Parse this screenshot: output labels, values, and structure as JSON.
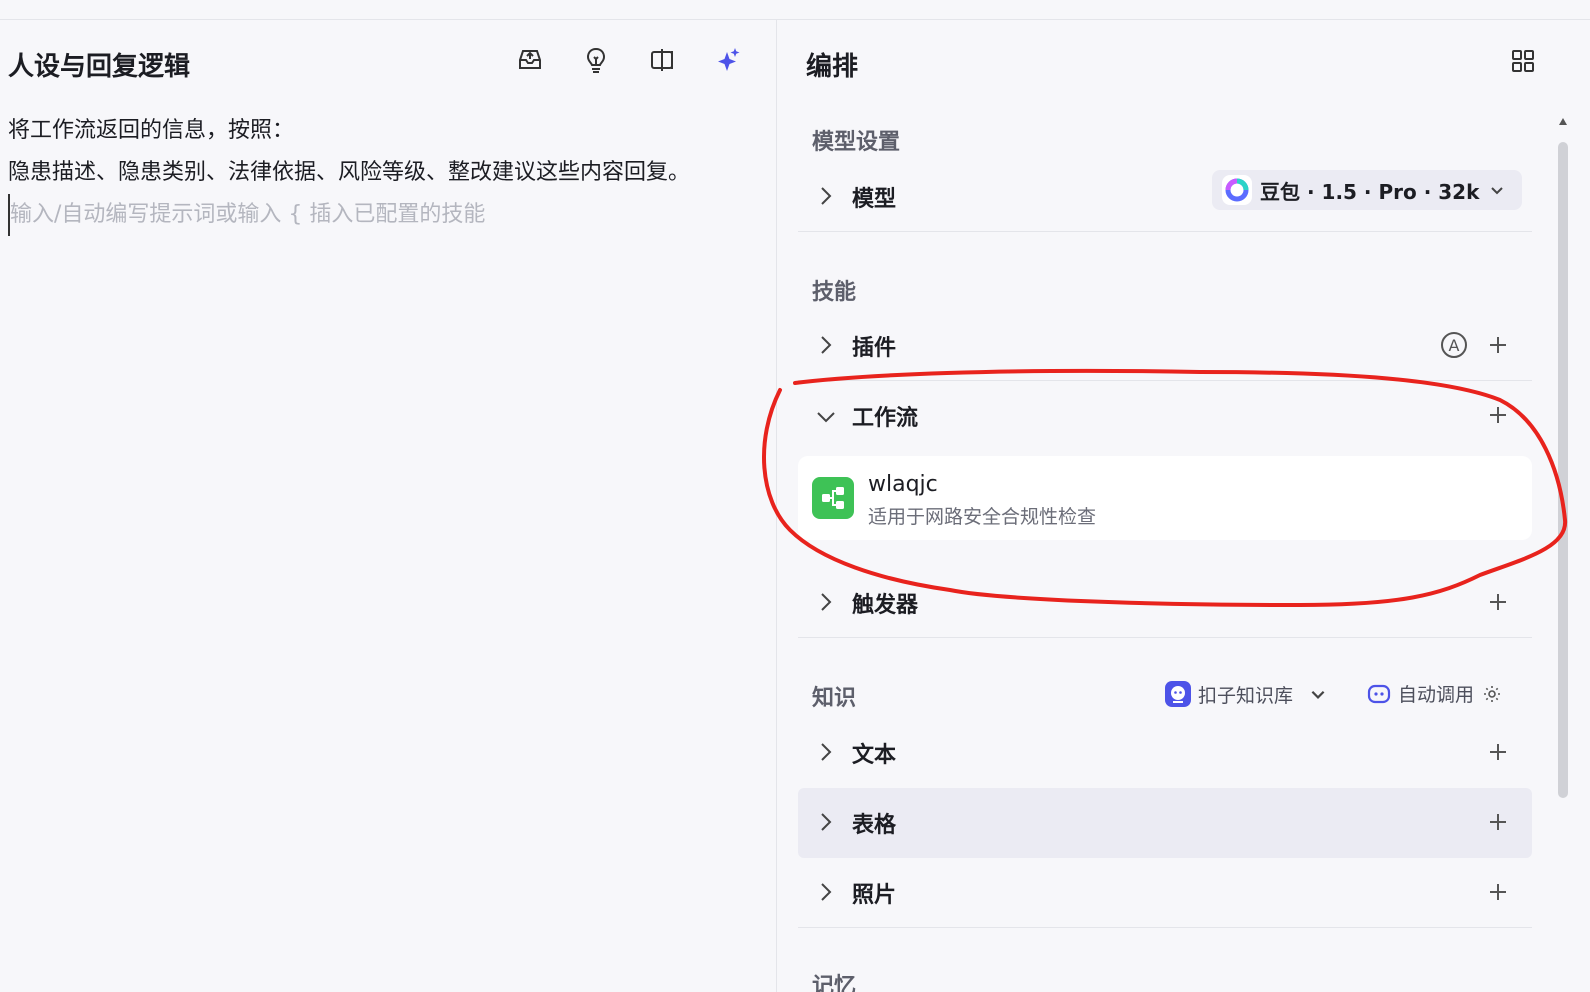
{
  "left": {
    "title": "人设与回复逻辑",
    "toolbar": {
      "icons": [
        "inbox-upload-icon",
        "lightbulb-icon",
        "compare-icon",
        "sparkle-icon"
      ],
      "accent": "#4d53e8"
    },
    "prompt_lines": [
      "将工作流返回的信息，按照：",
      "隐患描述、隐患类别、法律依据、风险等级、整改建议这些内容回复。"
    ],
    "placeholder": "输入/自动编写提示词或输入 { 插入已配置的技能"
  },
  "right": {
    "title": "编排",
    "model_section": {
      "label": "模型设置",
      "row_label": "模型",
      "model_name": "豆包 · 1.5 · Pro · 32k"
    },
    "skills_section": {
      "label": "技能",
      "plugin_label": "插件",
      "workflow_label": "工作流",
      "workflow_item": {
        "name": "wlaqjc",
        "description": "适用于网路安全合规性检查",
        "icon_color": "#3ec256"
      },
      "trigger_label": "触发器"
    },
    "knowledge_section": {
      "label": "知识",
      "kb_source": "扣子知识库",
      "auto_call": "自动调用",
      "text_label": "文本",
      "table_label": "表格",
      "photo_label": "照片"
    },
    "next_section_label": "记忆"
  },
  "annotation_color": "#e8231d"
}
